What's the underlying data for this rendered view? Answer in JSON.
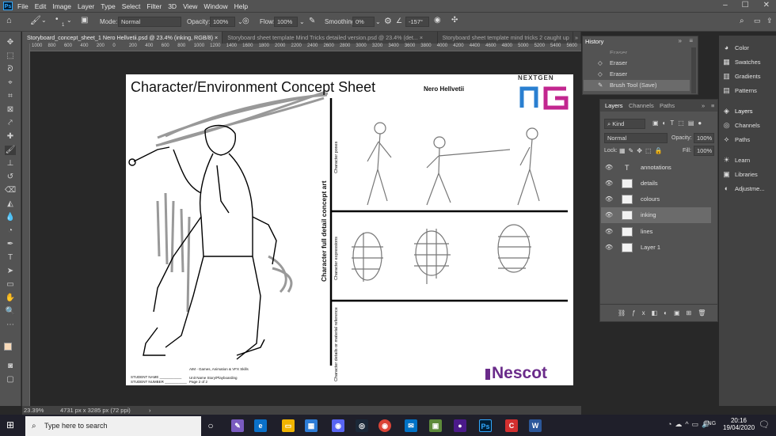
{
  "menu": [
    "File",
    "Edit",
    "Image",
    "Layer",
    "Type",
    "Select",
    "Filter",
    "3D",
    "View",
    "Window",
    "Help"
  ],
  "app_logo": "Ps",
  "options": {
    "brush_size": "1",
    "mode_label": "Mode:",
    "mode_value": "Normal",
    "opacity_label": "Opacity:",
    "opacity_value": "100%",
    "flow_label": "Flow:",
    "flow_value": "100%",
    "smoothing_label": "Smoothing:",
    "smoothing_value": "0%",
    "angle_value": "-157°"
  },
  "tabs": [
    {
      "label": "Storyboard_concept_sheet_1 Nero Hellvetii.psd @ 23.4% (inking, RGB/8)"
    },
    {
      "label": "Storyboard sheet template Mind Tricks detailed version.psd @ 23.4% (det..."
    },
    {
      "label": "Storyboard sheet template mind tricks 2 caught up"
    }
  ],
  "ruler_labels": [
    "1000",
    "800",
    "600",
    "400",
    "200",
    "0",
    "200",
    "400",
    "600",
    "800",
    "1000",
    "1200",
    "1400",
    "1600",
    "1800",
    "2000",
    "2200",
    "2400",
    "2600",
    "2800",
    "3000",
    "3200",
    "3400",
    "3600",
    "3800",
    "4000",
    "4200",
    "4400",
    "4600",
    "4800",
    "5000",
    "5200",
    "5400",
    "5600"
  ],
  "sheet": {
    "title": "Character/Environment Concept Sheet",
    "author": "Nero Hellvetii",
    "logo_top": "NEXTGEN",
    "vertical_label": "Character full detail concept art",
    "row1_label": "Character poses",
    "row2_label": "Character expressions",
    "row3_label": "Character details or material reference",
    "footer_student_name": "STUDENT NAME ___________",
    "footer_student_number": "STUDENT NUMBER ___________",
    "footer_course": "AIM - Games, Animation & VFX Skills",
    "footer_unit": "Unit Name Story/Playboarding",
    "footer_page": "Page 2 of 2",
    "footer_logo": "Nescot"
  },
  "status": {
    "zoom": "23.39%",
    "doc_size": "4731 px x 3285 px (72 ppi)"
  },
  "history": {
    "title": "History",
    "items": [
      "Eraser",
      "Eraser",
      "Brush Tool (Save)"
    ]
  },
  "layers_panel": {
    "tabs": [
      "Layers",
      "Channels",
      "Paths"
    ],
    "kind_label": "Kind",
    "blend_mode": "Normal",
    "opacity_label": "Opacity:",
    "opacity_value": "100%",
    "lock_label": "Lock:",
    "fill_label": "Fill:",
    "fill_value": "100%",
    "layers": [
      {
        "name": "annotations",
        "type": "text"
      },
      {
        "name": "details",
        "type": "pixel"
      },
      {
        "name": "colours",
        "type": "pixel"
      },
      {
        "name": "inking",
        "type": "pixel",
        "selected": true
      },
      {
        "name": "lines",
        "type": "pixel"
      },
      {
        "name": "Layer 1",
        "type": "pixel"
      }
    ]
  },
  "right_dock": [
    "Color",
    "Swatches",
    "Gradients",
    "Patterns",
    "Layers",
    "Channels",
    "Paths",
    "Learn",
    "Libraries",
    "Adjustme..."
  ],
  "taskbar": {
    "search_placeholder": "Type here to search",
    "time": "20:16",
    "date": "19/04/2020",
    "lang": "ENG"
  },
  "colors": {
    "ui_dark": "#535353",
    "canvas_bg": "#282828",
    "taskbar": "#1f1f2a",
    "ps_blue": "#31a8ff",
    "nescot_purple": "#6a2b8a"
  }
}
